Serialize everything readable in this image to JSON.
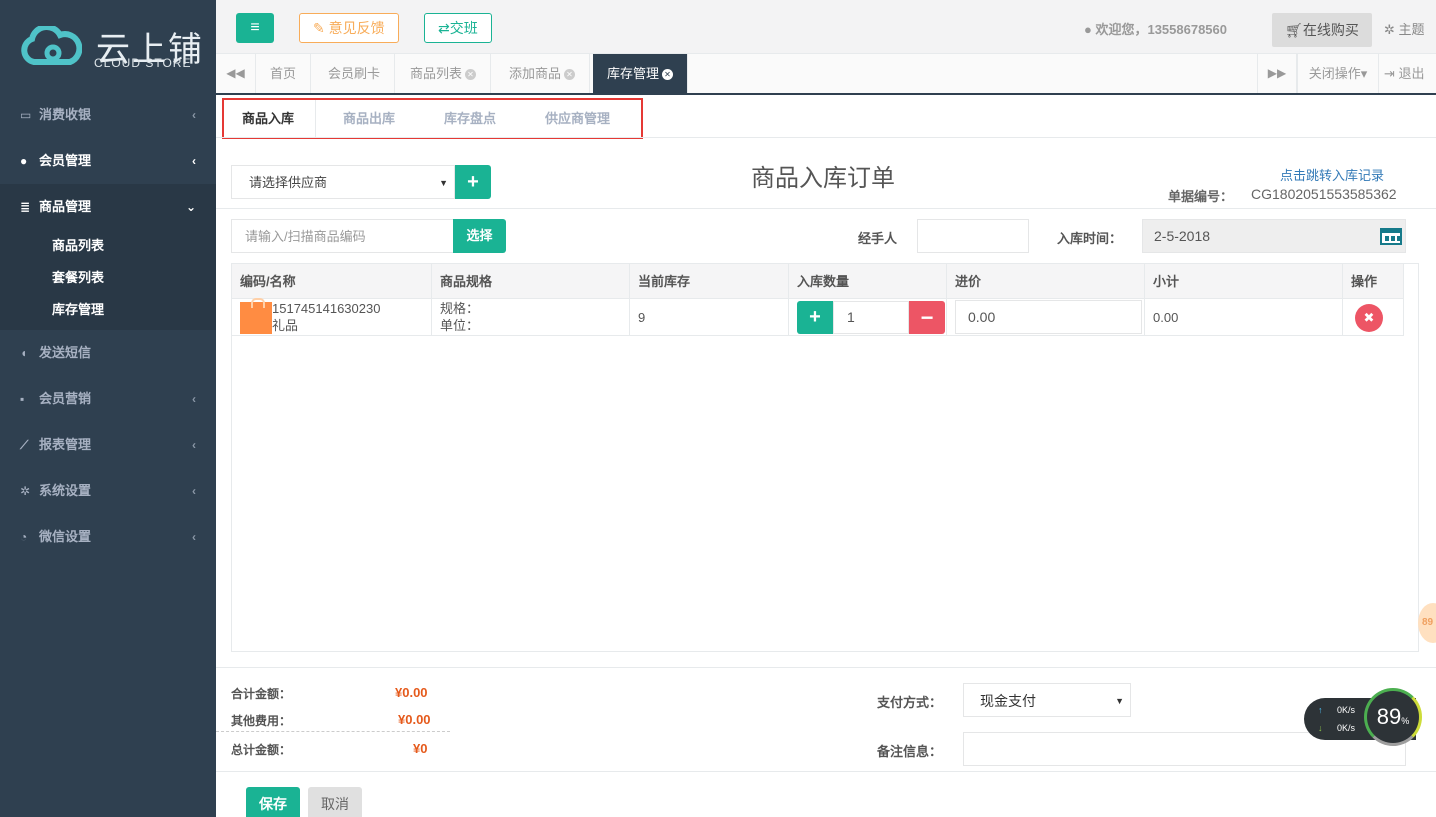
{
  "app": {
    "logo_main": "云上铺",
    "logo_sub": "CLOUD STORE"
  },
  "sidebar": {
    "items": [
      {
        "label": "消费收银",
        "icon": "card-icon",
        "arrow": "‹"
      },
      {
        "label": "会员管理",
        "icon": "user-icon",
        "arrow": "‹"
      },
      {
        "label": "商品管理",
        "icon": "database-icon",
        "arrow": "⌄"
      },
      {
        "label": "发送短信",
        "icon": "comment-icon",
        "arrow": ""
      },
      {
        "label": "会员营销",
        "icon": "briefcase-icon",
        "arrow": "‹"
      },
      {
        "label": "报表管理",
        "icon": "line-chart-icon",
        "arrow": "‹"
      },
      {
        "label": "系统设置",
        "icon": "gears-icon",
        "arrow": "‹"
      },
      {
        "label": "微信设置",
        "icon": "wechat-icon",
        "arrow": "‹"
      }
    ],
    "submenu": [
      "商品列表",
      "套餐列表",
      "库存管理"
    ]
  },
  "topbar": {
    "feedback": "意见反馈",
    "shift": "交班",
    "welcome": "欢迎您，13558678560",
    "buy": "在线购买",
    "theme": "主题"
  },
  "tabs": {
    "items": [
      "首页",
      "会员刷卡",
      "商品列表",
      "添加商品",
      "库存管理"
    ],
    "close_ops": "关闭操作",
    "logout": "退出"
  },
  "subtabs": [
    "商品入库",
    "商品出库",
    "库存盘点",
    "供应商管理"
  ],
  "order": {
    "supplier_placeholder": "请选择供应商",
    "title": "商品入库订单",
    "record_link": "点击跳转入库记录",
    "doc_no_label": "单据编号：",
    "doc_no": "CG1802051553585362",
    "code_placeholder": "请输入/扫描商品编码",
    "choose_btn": "选择",
    "handler_label": "经手人",
    "time_label": "入库时间：",
    "time_value": "2-5-2018"
  },
  "table": {
    "headers": [
      "编码/名称",
      "商品规格",
      "当前库存",
      "入库数量",
      "进价",
      "小计",
      "操作"
    ],
    "rows": [
      {
        "code": "151745141630230",
        "name": "礼品",
        "spec": "规格：",
        "unit": "单位：",
        "stock": "9",
        "qty": "1",
        "price": "0.00",
        "subtotal": "0.00"
      }
    ]
  },
  "summary": {
    "total_label": "合计金额：",
    "total": "¥0.00",
    "other_label": "其他费用：",
    "other": "¥0.00",
    "grand_label": "总计金额：",
    "grand": "¥0",
    "pay_label": "支付方式：",
    "pay_value": "现金支付",
    "remark_label": "备注信息："
  },
  "actions": {
    "save": "保存",
    "cancel": "取消"
  },
  "widget": {
    "up": "0K/s",
    "down": "0K/s",
    "percent": "89",
    "unit": "%",
    "side": "89"
  },
  "colors": {
    "sidebar": "#2f4050",
    "primary": "#1ab394",
    "danger": "#ed5565",
    "warning": "#f8ac59",
    "price": "#e55a1c"
  }
}
